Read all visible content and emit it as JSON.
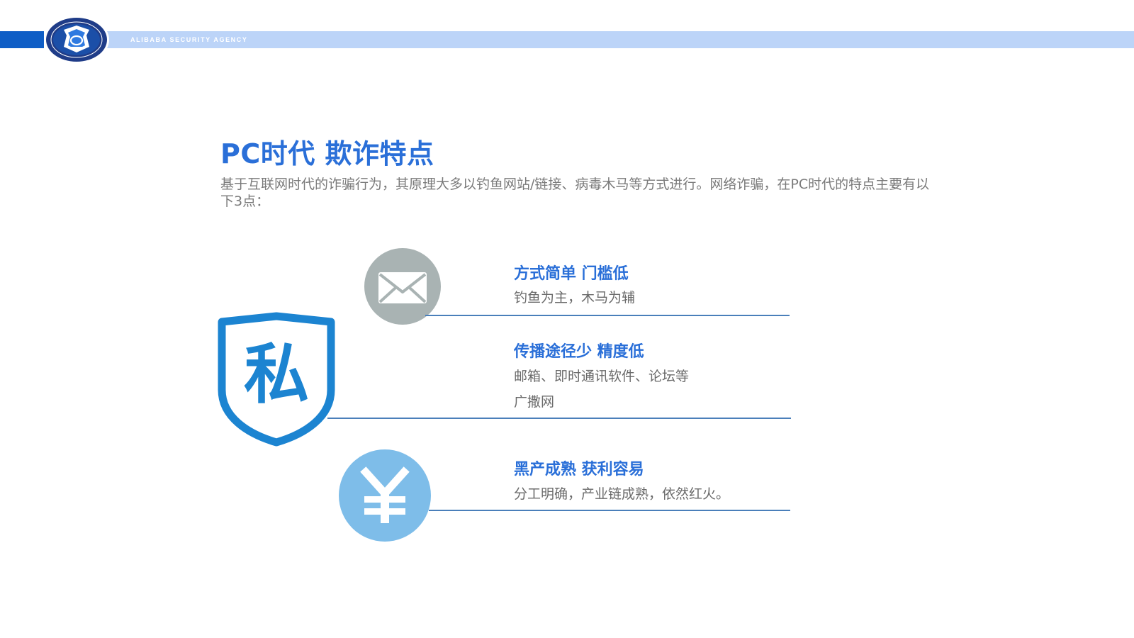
{
  "header": {
    "brand_text": "ALIBABA SECURITY AGENCY"
  },
  "colors": {
    "accent": "#2a6fd8",
    "band_dark": "#0f5ec6",
    "band_light": "#bcd4f8",
    "mail_icon": "#a9b3b3",
    "yen_icon": "#7ebde9",
    "shield": "#1c84d1"
  },
  "slide": {
    "title": "PC时代 欺诈特点",
    "intro": "基于互联网时代的诈骗行为，其原理大多以钓鱼网站/链接、病毒木马等方式进行。网络诈骗，在PC时代的特点主要有以下3点："
  },
  "shield_icon": {
    "glyph": "私"
  },
  "features": [
    {
      "icon": "mail-icon",
      "title": "方式简单 门槛低",
      "lines": [
        "钓鱼为主，木马为辅"
      ]
    },
    {
      "icon": "shield-icon",
      "title": "传播途径少 精度低",
      "lines": [
        "邮箱、即时通讯软件、论坛等",
        "广撒网"
      ]
    },
    {
      "icon": "yen-icon",
      "title": "黑产成熟 获利容易",
      "lines": [
        "分工明确，产业链成熟，依然红火。"
      ]
    }
  ]
}
